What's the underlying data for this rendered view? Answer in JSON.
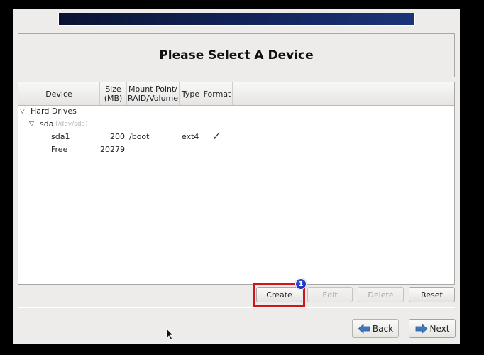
{
  "window": {
    "title": "Please Select A Device",
    "banner_colors": [
      "#0b1333",
      "#1b3478"
    ]
  },
  "tree": {
    "columns": [
      "Device",
      "Size\n(MB)",
      "Mount Point/\nRAID/Volume",
      "Type",
      "Format"
    ],
    "column_labels": {
      "device": "Device",
      "size_line1": "Size",
      "size_line2": "(MB)",
      "mount_line1": "Mount Point/",
      "mount_line2": "RAID/Volume",
      "type": "Type",
      "format": "Format"
    },
    "rows": [
      {
        "level": 0,
        "expanded": true,
        "device": "Hard Drives"
      },
      {
        "level": 1,
        "expanded": true,
        "device": "sda",
        "sublabel": "(/dev/sda)"
      },
      {
        "level": 2,
        "device": "sda1",
        "size": "200",
        "mount": "/boot",
        "type": "ext4",
        "format": "✓"
      },
      {
        "level": 2,
        "device": "Free",
        "size": "20279",
        "mount": "",
        "type": "",
        "format": ""
      }
    ]
  },
  "actions": {
    "create": "Create",
    "edit": "Edit",
    "delete": "Delete",
    "reset": "Reset"
  },
  "annotation": {
    "badge": "1",
    "highlight_color": "#d0141a"
  },
  "nav": {
    "back": "Back",
    "next": "Next"
  }
}
